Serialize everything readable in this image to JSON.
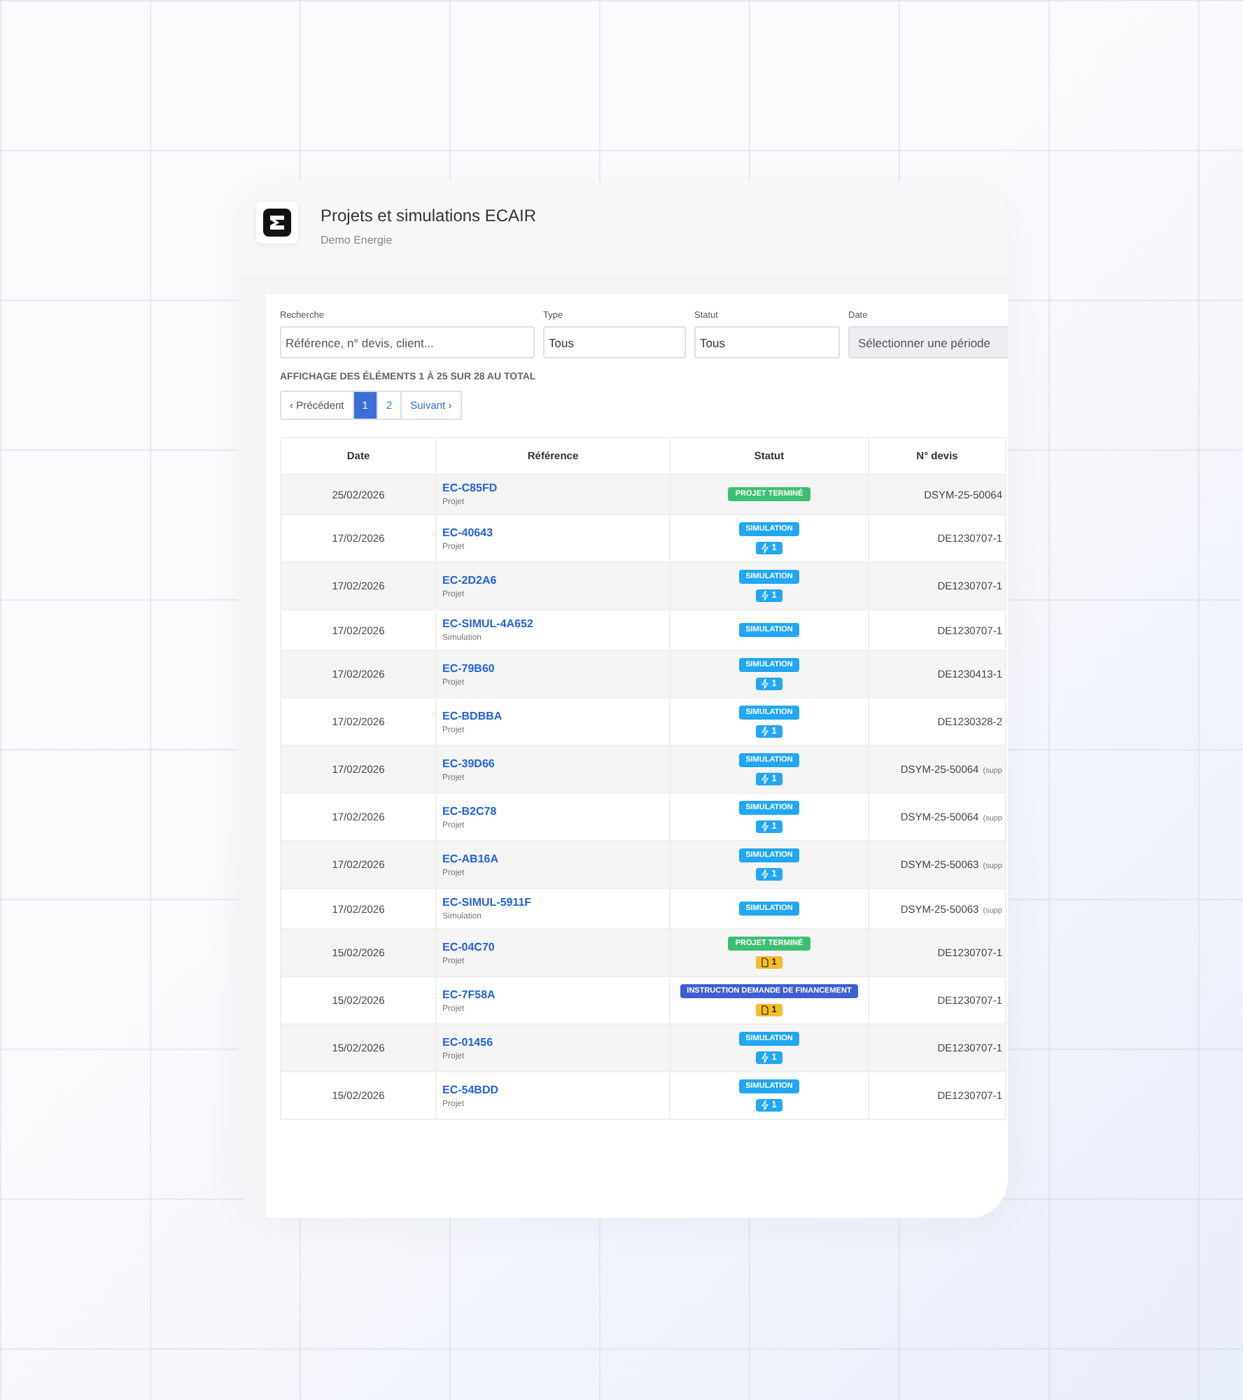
{
  "header": {
    "title": "Projets et simulations ECAIR",
    "subtitle": "Demo Energie"
  },
  "filters": [
    {
      "label": "Recherche",
      "placeholder": "Référence, n° devis, client...",
      "kind": "search"
    },
    {
      "label": "Type",
      "value": "Tous",
      "kind": "select"
    },
    {
      "label": "Statut",
      "value": "Tous",
      "kind": "select"
    },
    {
      "label": "Date",
      "placeholder": "Sélectionner une période",
      "kind": "date"
    }
  ],
  "summary": "AFFICHAGE DES ÉLÉMENTS 1 À 25 SUR 28 AU TOTAL",
  "pagination": [
    {
      "label": "‹ Précédent",
      "selected": false
    },
    {
      "label": "1",
      "selected": true
    },
    {
      "label": "2",
      "selected": false
    },
    {
      "label": "Suivant ›",
      "selected": false
    }
  ],
  "table": {
    "columns": [
      "Date",
      "Référence",
      "Statut",
      "N° devis"
    ],
    "rows": [
      {
        "date": "25/02/2026",
        "reference": "EC-C85FD",
        "type": "Projet",
        "status": {
          "label": "PROJET TERMINÉ",
          "kind": "done"
        },
        "devis": "DSYM-25-50064"
      },
      {
        "date": "17/02/2026",
        "reference": "EC-40643",
        "type": "Projet",
        "status": {
          "label": "SIMULATION",
          "kind": "simulation"
        },
        "count": {
          "label": "1",
          "kind": "bolt"
        },
        "devis": "DE1230707-1"
      },
      {
        "date": "17/02/2026",
        "reference": "EC-2D2A6",
        "type": "Projet",
        "status": {
          "label": "SIMULATION",
          "kind": "simulation"
        },
        "count": {
          "label": "1",
          "kind": "bolt"
        },
        "devis": "DE1230707-1"
      },
      {
        "date": "17/02/2026",
        "reference": "EC-SIMUL-4A652",
        "type": "Simulation",
        "status": {
          "label": "SIMULATION",
          "kind": "simulation"
        },
        "devis": "DE1230707-1"
      },
      {
        "date": "17/02/2026",
        "reference": "EC-79B60",
        "type": "Projet",
        "status": {
          "label": "SIMULATION",
          "kind": "simulation"
        },
        "count": {
          "label": "1",
          "kind": "bolt"
        },
        "devis": "DE1230413-1"
      },
      {
        "date": "17/02/2026",
        "reference": "EC-BDBBA",
        "type": "Projet",
        "status": {
          "label": "SIMULATION",
          "kind": "simulation"
        },
        "count": {
          "label": "1",
          "kind": "bolt"
        },
        "devis": "DE1230328-2"
      },
      {
        "date": "17/02/2026",
        "reference": "EC-39D66",
        "type": "Projet",
        "status": {
          "label": "SIMULATION",
          "kind": "simulation"
        },
        "count": {
          "label": "1",
          "kind": "bolt"
        },
        "devis": "DSYM-25-50064",
        "note": "(supp"
      },
      {
        "date": "17/02/2026",
        "reference": "EC-B2C78",
        "type": "Projet",
        "status": {
          "label": "SIMULATION",
          "kind": "simulation"
        },
        "count": {
          "label": "1",
          "kind": "bolt"
        },
        "devis": "DSYM-25-50064",
        "note": "(supp"
      },
      {
        "date": "17/02/2026",
        "reference": "EC-AB16A",
        "type": "Projet",
        "status": {
          "label": "SIMULATION",
          "kind": "simulation"
        },
        "count": {
          "label": "1",
          "kind": "bolt"
        },
        "devis": "DSYM-25-50063",
        "note": "(supp"
      },
      {
        "date": "17/02/2026",
        "reference": "EC-SIMUL-5911F",
        "type": "Simulation",
        "status": {
          "label": "SIMULATION",
          "kind": "simulation"
        },
        "devis": "DSYM-25-50063",
        "note": "(supp"
      },
      {
        "date": "15/02/2026",
        "reference": "EC-04C70",
        "type": "Projet",
        "status": {
          "label": "PROJET TERMINÉ",
          "kind": "done"
        },
        "count": {
          "label": "1",
          "kind": "doc"
        },
        "devis": "DE1230707-1"
      },
      {
        "date": "15/02/2026",
        "reference": "EC-7F58A",
        "type": "Projet",
        "status": {
          "label": "INSTRUCTION DEMANDE DE FINANCEMENT",
          "kind": "instruction"
        },
        "count": {
          "label": "1",
          "kind": "doc"
        },
        "devis": "DE1230707-1"
      },
      {
        "date": "15/02/2026",
        "reference": "EC-01456",
        "type": "Projet",
        "status": {
          "label": "SIMULATION",
          "kind": "simulation"
        },
        "count": {
          "label": "1",
          "kind": "bolt"
        },
        "devis": "DE1230707-1"
      },
      {
        "date": "15/02/2026",
        "reference": "EC-54BDD",
        "type": "Projet",
        "status": {
          "label": "SIMULATION",
          "kind": "simulation"
        },
        "count": {
          "label": "1",
          "kind": "bolt"
        },
        "devis": "DE1230707-1"
      }
    ]
  }
}
